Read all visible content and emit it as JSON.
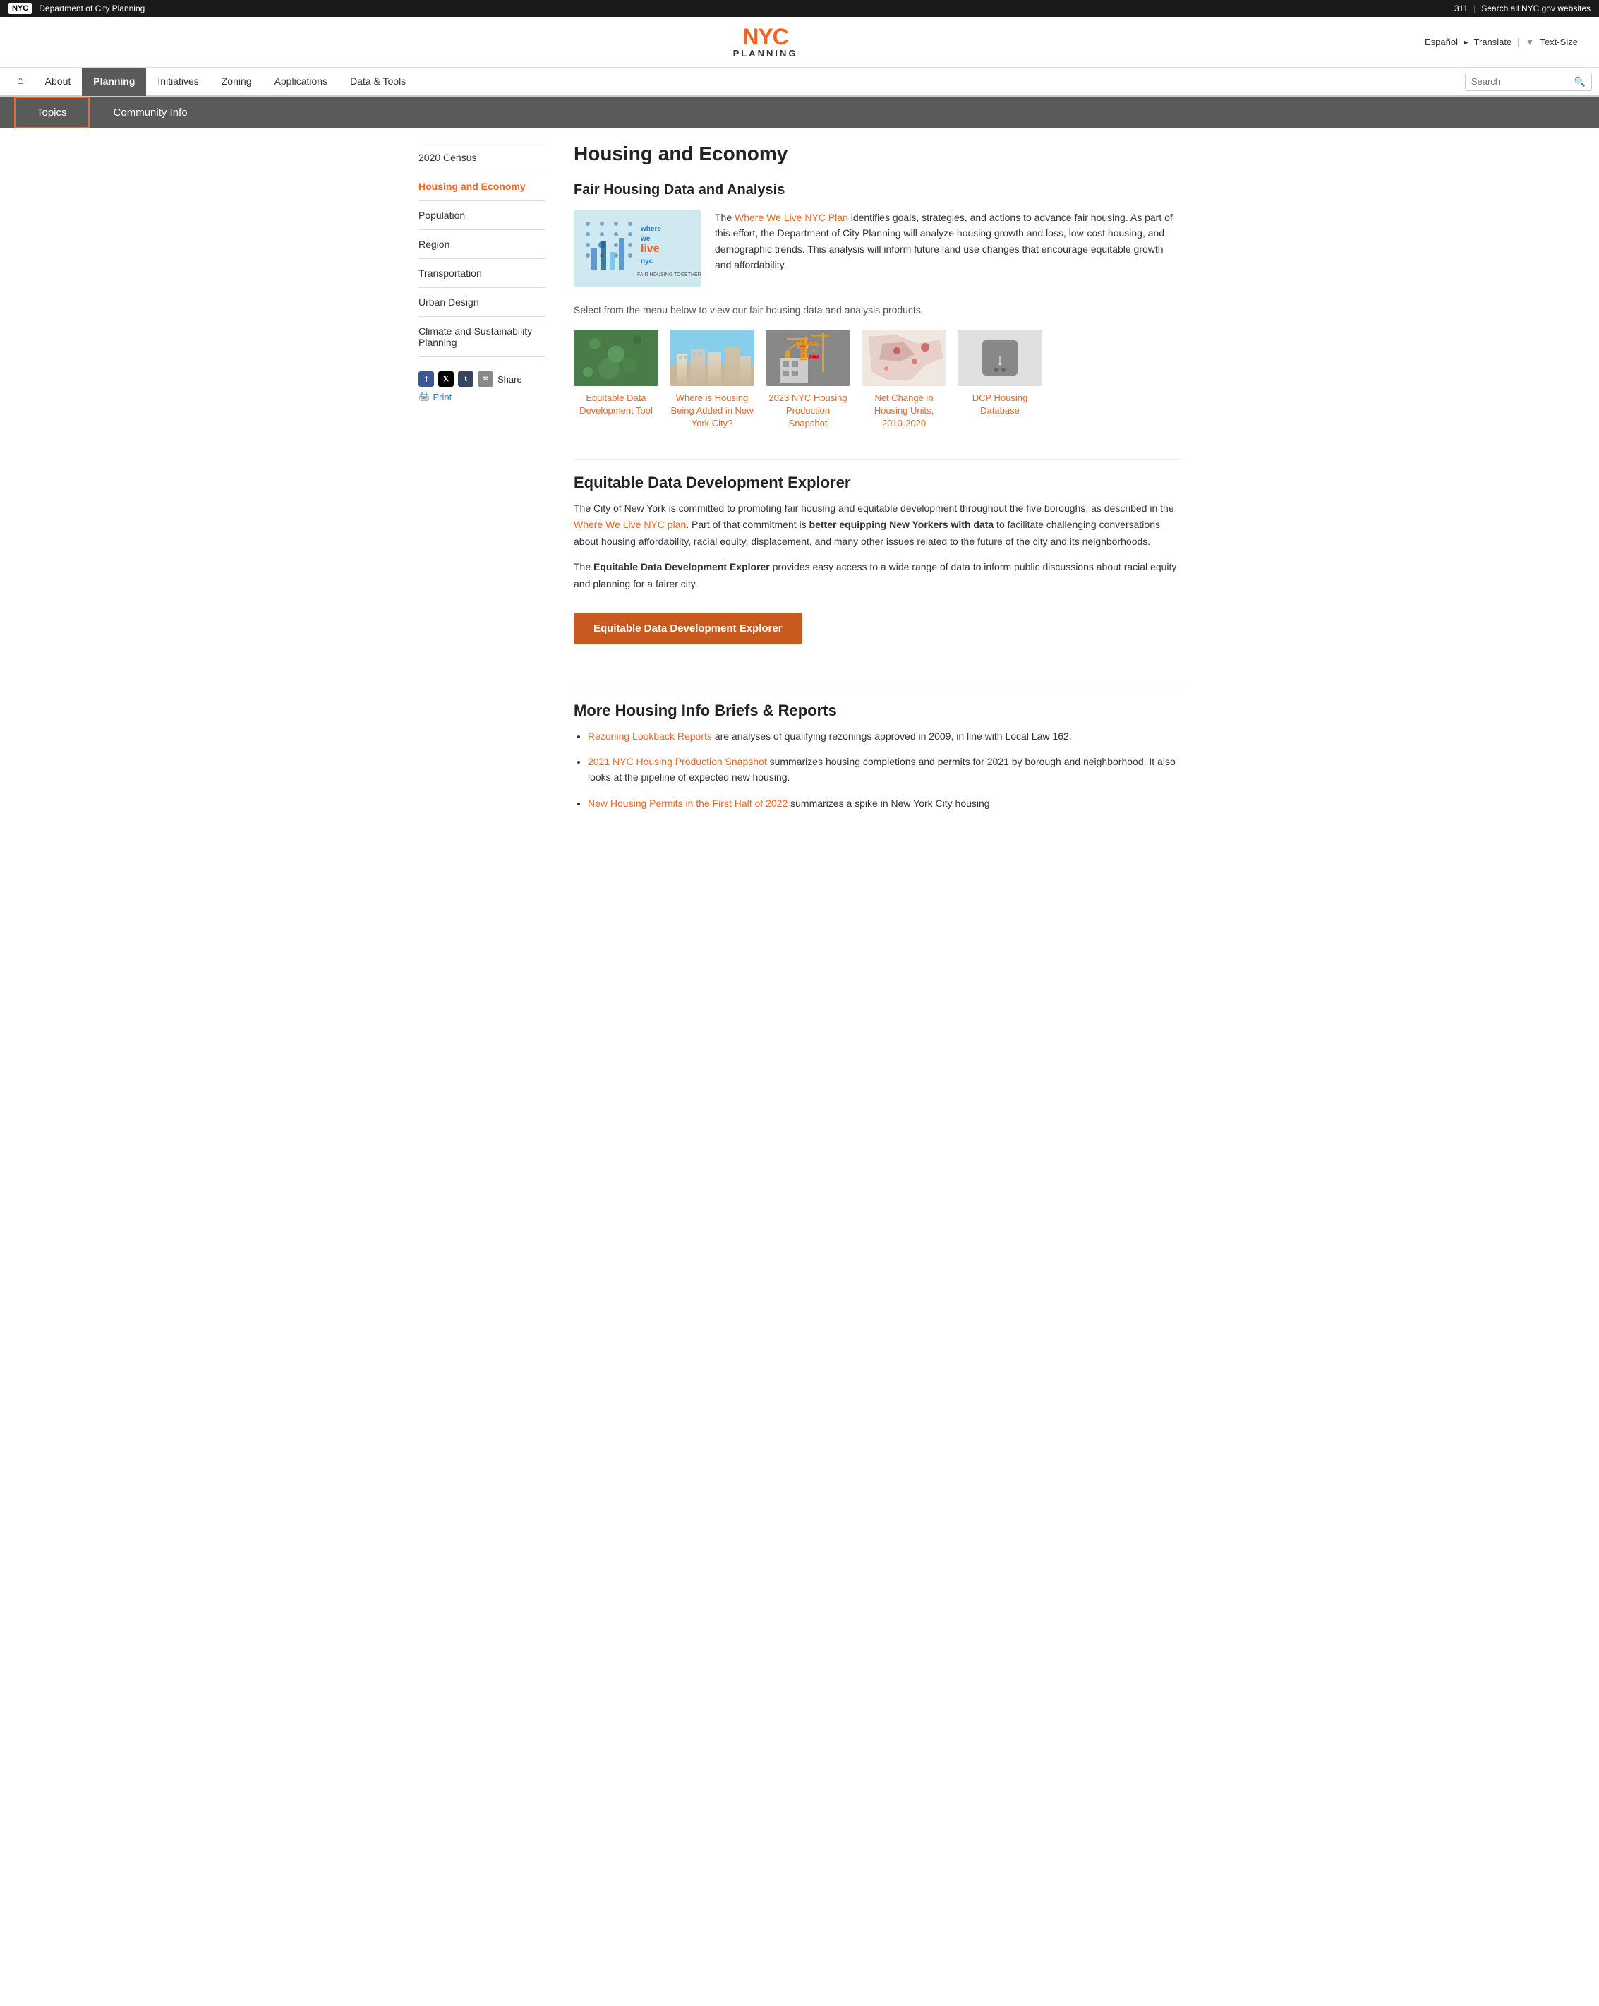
{
  "topbar": {
    "logo": "NYC",
    "dept": "Department of City Planning",
    "phone": "311",
    "search_all": "Search all NYC.gov websites"
  },
  "header": {
    "logo_nyc": "NYC",
    "logo_sub": "PLANNING",
    "lang": "Español",
    "translate": "Translate",
    "textsize": "Text-Size"
  },
  "nav": {
    "home_icon": "⌂",
    "items": [
      {
        "label": "About",
        "active": false
      },
      {
        "label": "Planning",
        "active": true
      },
      {
        "label": "Initiatives",
        "active": false
      },
      {
        "label": "Zoning",
        "active": false
      },
      {
        "label": "Applications",
        "active": false
      },
      {
        "label": "Data & Tools",
        "active": false
      }
    ],
    "search_placeholder": "Search"
  },
  "subnav": {
    "items": [
      {
        "label": "Topics",
        "active": true
      },
      {
        "label": "Community Info",
        "active": false
      }
    ]
  },
  "sidebar": {
    "items": [
      {
        "label": "2020 Census",
        "active": false
      },
      {
        "label": "Housing and Economy",
        "active": true
      },
      {
        "label": "Population",
        "active": false
      },
      {
        "label": "Region",
        "active": false
      },
      {
        "label": "Transportation",
        "active": false
      },
      {
        "label": "Urban Design",
        "active": false
      },
      {
        "label": "Climate and Sustainability Planning",
        "active": false
      }
    ],
    "share_label": "Share",
    "print_label": "Print"
  },
  "content": {
    "page_title": "Housing and Economy",
    "fair_housing": {
      "section_title": "Fair Housing Data and Analysis",
      "logo_alt": "Where We Live NYC - Fair Housing Together",
      "description_parts": [
        "The ",
        "Where We Live NYC Plan",
        " identifies goals, strategies, and actions to advance fair housing. As part of this effort, the Department of City Planning will analyze housing growth and loss, low-cost housing, and demographic trends. This analysis will inform future land use changes that encourage equitable growth and affordability."
      ],
      "select_text": "Select from the menu below to view our fair housing data and analysis products."
    },
    "data_cards": [
      {
        "label": "Equitable Data Development Tool",
        "img_class": "img-equitable"
      },
      {
        "label": "Where is Housing Being Added in New York City?",
        "img_class": "img-where"
      },
      {
        "label": "2023 NYC Housing Production Snapshot",
        "img_class": "img-housing-prod"
      },
      {
        "label": "Net Change in Housing Units, 2010-2020",
        "img_class": "img-net-change"
      },
      {
        "label": "DCP Housing Database",
        "img_class": "img-dcp"
      }
    ],
    "explorer": {
      "title": "Equitable Data Development Explorer",
      "para1_parts": [
        "The City of New York is committed to promoting fair housing and equitable development throughout the five boroughs, as described in the ",
        "Where We Live NYC plan",
        ". Part of that commitment is ",
        "better equipping New Yorkers with data",
        " to facilitate challenging conversations about housing affordability, racial equity, displacement, and many other issues related to the future of the city and its neighborhoods."
      ],
      "para2_parts": [
        "The ",
        "Equitable Data Development Explorer",
        " provides easy access to a wide range of data to inform public discussions about racial equity and planning for a fairer city."
      ],
      "cta_label": "Equitable Data Development Explorer"
    },
    "more_housing": {
      "title": "More Housing Info Briefs & Reports",
      "items": [
        {
          "link": "Rezoning Lookback Reports",
          "text": " are analyses of qualifying rezonings approved in 2009, in line with Local Law 162."
        },
        {
          "link": "2021 NYC Housing Production Snapshot",
          "text": " summarizes housing completions and permits for 2021 by borough and neighborhood. It also looks at the pipeline of expected new housing."
        },
        {
          "link": "New Housing Permits in the First Half of 2022",
          "text": " summarizes a spike in New York City housing"
        }
      ]
    }
  }
}
